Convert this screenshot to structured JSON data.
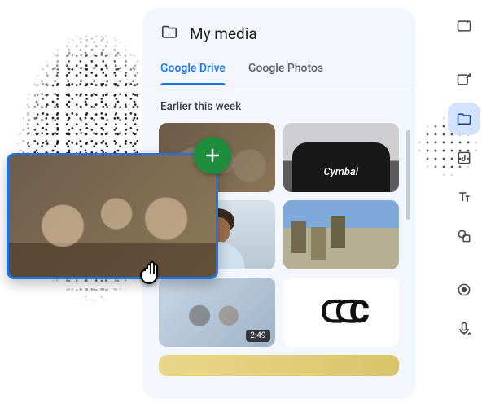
{
  "panel": {
    "title": "My media",
    "tabs": [
      "Google Drive",
      "Google Photos"
    ],
    "active_tab_index": 0,
    "section_heading": "Earlier this week",
    "thumbs": {
      "tshirt_label": "Cymbal",
      "video_duration": "2:49"
    }
  },
  "drag": {
    "badge": "add",
    "cursor": "grab"
  },
  "rail": {
    "items": [
      {
        "name": "sparkle-image-icon",
        "active": false
      },
      {
        "name": "image-edit-icon",
        "active": false
      },
      {
        "name": "folder-icon",
        "active": true
      },
      {
        "name": "audio-icon",
        "active": false
      },
      {
        "name": "text-icon",
        "active": false
      },
      {
        "name": "shape-icon",
        "active": false
      }
    ],
    "footer": [
      {
        "name": "record-icon"
      },
      {
        "name": "voice-upload-icon"
      }
    ]
  }
}
